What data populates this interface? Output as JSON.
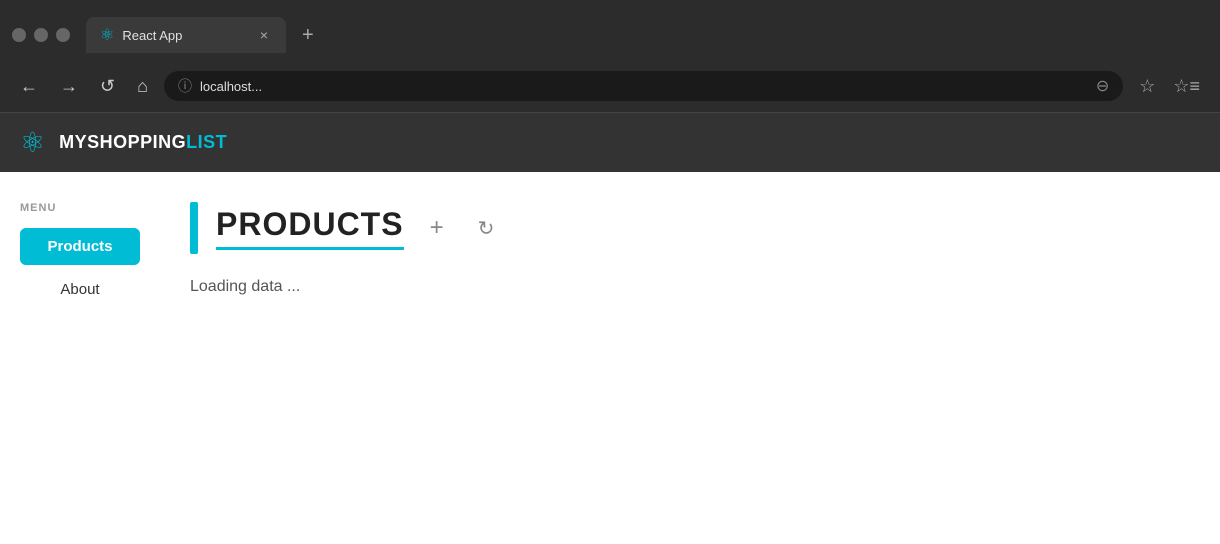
{
  "browser": {
    "traffic_lights": [
      "close",
      "minimize",
      "maximize"
    ],
    "tab": {
      "favicon": "⚛",
      "title": "React App",
      "close_label": "×"
    },
    "new_tab_label": "+",
    "nav": {
      "back_label": "←",
      "forward_label": "→",
      "reload_label": "↺",
      "home_label": "⌂",
      "address": "localhost...",
      "zoom_label": "⊖",
      "bookmark_label": "☆",
      "bookmarks_label": "☆≡"
    }
  },
  "app": {
    "logo": "⚛",
    "title_my": "MY",
    "title_shopping": "SHOPPING",
    "title_list": "LIST"
  },
  "sidebar": {
    "menu_label": "MENU",
    "items": [
      {
        "label": "Products",
        "active": true
      },
      {
        "label": "About",
        "active": false
      }
    ]
  },
  "main": {
    "page_title": "PRODUCTS",
    "add_button_label": "+",
    "refresh_button_label": "↻",
    "loading_text": "Loading data ..."
  }
}
